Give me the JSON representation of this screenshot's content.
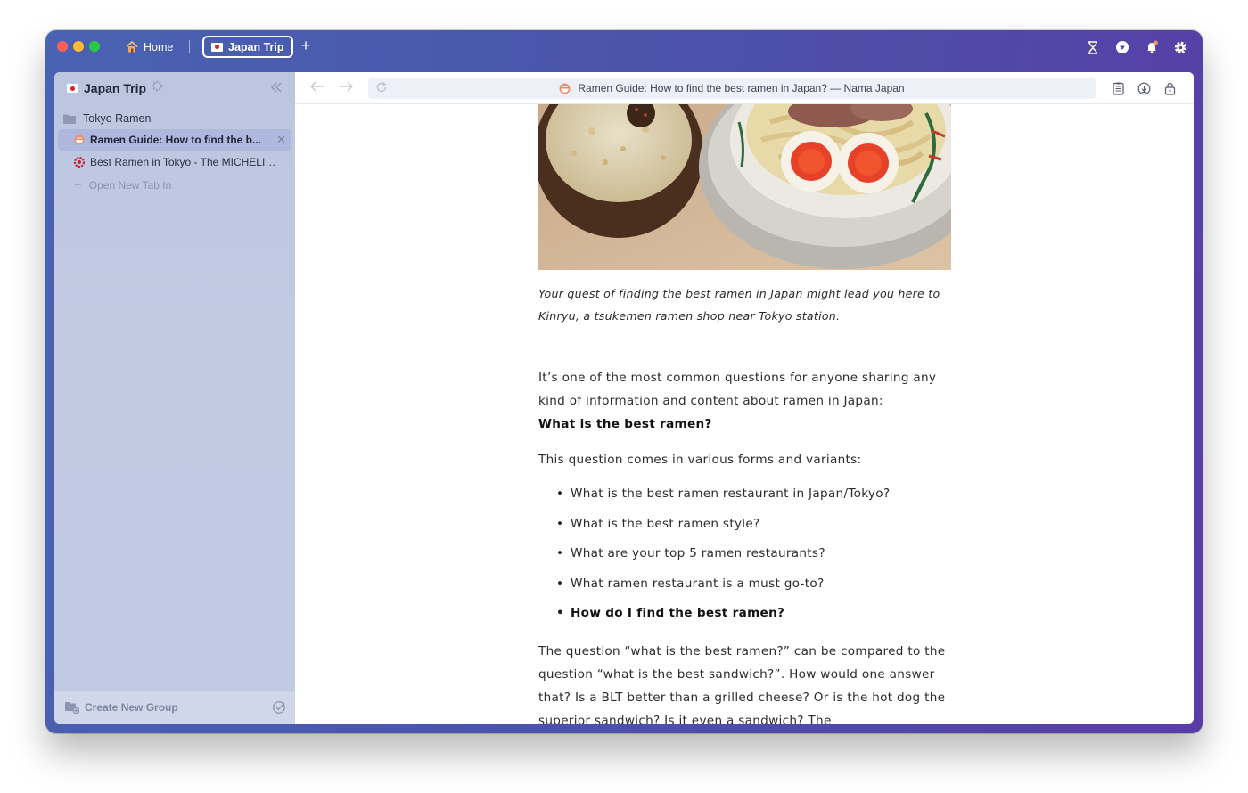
{
  "window": {
    "tabs": [
      {
        "label": "Home",
        "icon": "house-icon"
      },
      {
        "label": "Japan Trip",
        "icon": "japan-flag-icon",
        "active": true
      }
    ],
    "toolbar_icons": [
      "hourglass-icon",
      "shield-icon",
      "bell-icon",
      "gear-icon"
    ]
  },
  "sidebar": {
    "title": "Japan Trip",
    "group_name": "Tokyo Ramen",
    "items": [
      {
        "label": "Ramen Guide: How to find the b...",
        "active": true,
        "icon": "ramen-favicon"
      },
      {
        "label": "Best Ramen in Tokyo - The MICHELIN...",
        "active": false,
        "icon": "michelin-favicon"
      }
    ],
    "new_tab_label": "Open New Tab In",
    "footer_label": "Create New Group"
  },
  "browser": {
    "page_title": "Ramen Guide: How to find the best ramen in Japan? — Nama Japan"
  },
  "article": {
    "caption": "Your quest of finding the best ramen in Japan might lead you here to Kinryu, a tsukemen ramen shop near Tokyo station.",
    "intro": "It’s one of the most common questions for anyone sharing any kind of information and content about ramen in Japan:",
    "intro_bold": "What is the best ramen?",
    "variants_intro": "This question comes in various forms and variants:",
    "bullets": [
      "What is the best ramen restaurant in Japan/Tokyo?",
      "What is the best ramen style?",
      "What are your top 5 ramen restaurants?",
      "What ramen restaurant is a must go-to?",
      "How do I find the best ramen?"
    ],
    "closing": "The question “what is the best ramen?” can be compared to the question “what is the best sandwich?”. How would one answer that? Is a BLT better than a grilled cheese? Or is the hot dog the superior sandwich? Is it even a sandwich? The"
  }
}
